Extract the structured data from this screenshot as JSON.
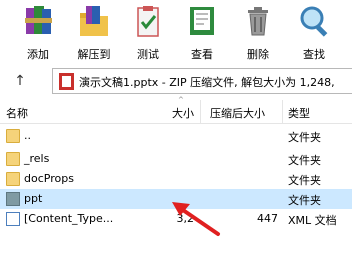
{
  "toolbar": {
    "add": "添加",
    "extract": "解压到",
    "test": "测试",
    "view": "查看",
    "delete": "删除",
    "find": "查找"
  },
  "address": {
    "path": "演示文稿1.pptx - ZIP 压缩文件, 解包大小为 1,248,"
  },
  "columns": {
    "name": "名称",
    "size": "大小",
    "packed": "压缩后大小",
    "type": "类型"
  },
  "rows": [
    {
      "name": "..",
      "size": "",
      "packed": "",
      "type": "文件夹"
    },
    {
      "name": "_rels",
      "size": "",
      "packed": "",
      "type": "文件夹"
    },
    {
      "name": "docProps",
      "size": "",
      "packed": "",
      "type": "文件夹"
    },
    {
      "name": "ppt",
      "size": "",
      "packed": "",
      "type": "文件夹"
    },
    {
      "name": "[Content_Type...",
      "size": "3,2",
      "packed": "447",
      "type": "XML 文档"
    }
  ]
}
